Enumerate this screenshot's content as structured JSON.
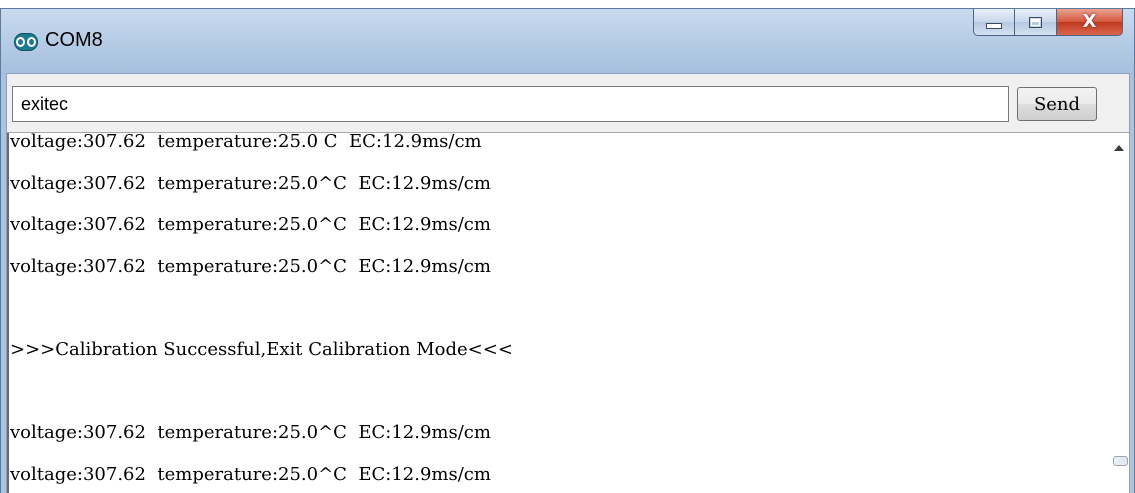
{
  "window": {
    "title": "COM8",
    "app_icon": "arduino-infinity-icon",
    "controls": {
      "minimize_icon": "minimize-icon",
      "maximize_icon": "maximize-icon",
      "close_label": "X"
    }
  },
  "send_bar": {
    "input_value": "exitec",
    "send_label": "Send"
  },
  "serial_output": {
    "lines": [
      "voltage:307.62  temperature:25.0 C  EC:12.9ms/cm",
      "voltage:307.62  temperature:25.0^C  EC:12.9ms/cm",
      "voltage:307.62  temperature:25.0^C  EC:12.9ms/cm",
      "voltage:307.62  temperature:25.0^C  EC:12.9ms/cm",
      "",
      ">>>Calibration Successful,Exit Calibration Mode<<<",
      "",
      "voltage:307.62  temperature:25.0^C  EC:12.9ms/cm",
      "voltage:307.62  temperature:25.0^C  EC:12.9ms/cm"
    ]
  }
}
